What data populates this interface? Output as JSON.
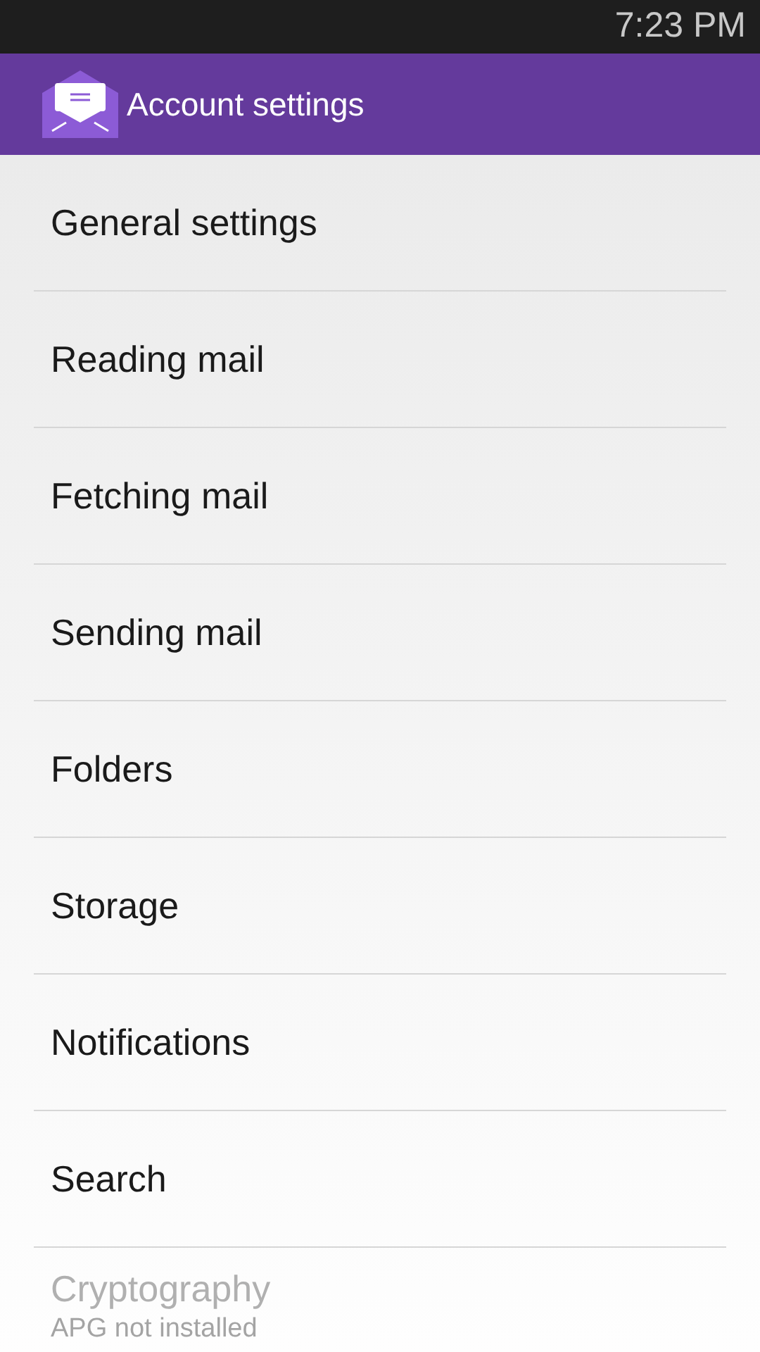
{
  "status_bar": {
    "time": "7:23 PM"
  },
  "app_bar": {
    "title": "Account settings"
  },
  "items": [
    {
      "title": "General settings",
      "disabled": false
    },
    {
      "title": "Reading mail",
      "disabled": false
    },
    {
      "title": "Fetching mail",
      "disabled": false
    },
    {
      "title": "Sending mail",
      "disabled": false
    },
    {
      "title": "Folders",
      "disabled": false
    },
    {
      "title": "Storage",
      "disabled": false
    },
    {
      "title": "Notifications",
      "disabled": false
    },
    {
      "title": "Search",
      "disabled": false
    },
    {
      "title": "Cryptography",
      "summary": "APG not installed",
      "disabled": true
    }
  ]
}
